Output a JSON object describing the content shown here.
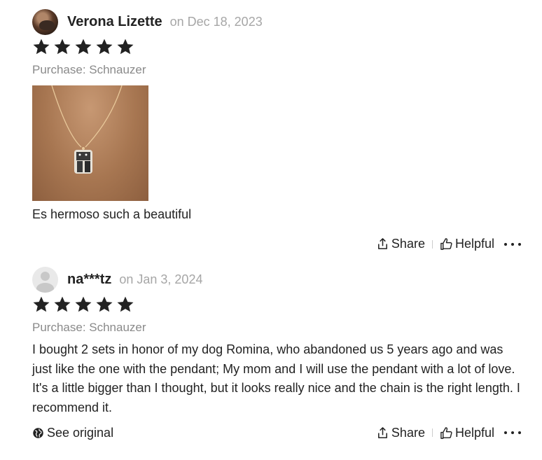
{
  "reviews": [
    {
      "reviewer_name": "Verona Lizette",
      "date": "on Dec 18, 2023",
      "rating": 5,
      "purchase": "Purchase: Schnauzer",
      "text": "Es hermoso such a beautiful",
      "actions": {
        "share": "Share",
        "helpful": "Helpful"
      }
    },
    {
      "reviewer_name": "na***tz",
      "date": "on Jan 3, 2024",
      "rating": 5,
      "purchase": "Purchase: Schnauzer",
      "text": "I bought 2 sets in honor of my dog Romina, who abandoned us 5 years ago and was just like the one with the pendant; My mom and I will use the pendant with a lot of love. It's a little bigger than I thought, but it looks really nice and the chain is the right length. I recommend it.",
      "see_original": "See original",
      "actions": {
        "share": "Share",
        "helpful": "Helpful"
      }
    }
  ],
  "colors": {
    "text": "#222222",
    "muted": "#8a8a8a",
    "date": "#a6a6a6",
    "star": "#222222"
  }
}
